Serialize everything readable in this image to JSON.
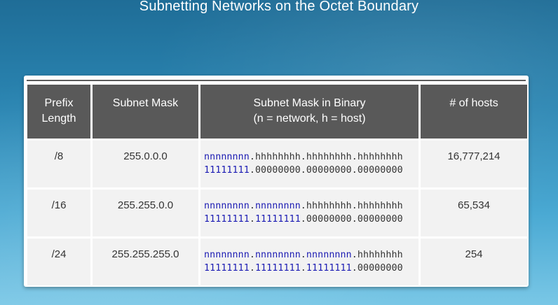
{
  "page": {
    "title": "Subnetting Networks on the Octet Boundary"
  },
  "table": {
    "headers": {
      "prefix_line1": "Prefix",
      "prefix_line2": "Length",
      "mask": "Subnet Mask",
      "binary_line1": "Subnet Mask in Binary",
      "binary_line2": "(n = network, h = host)",
      "hosts": "# of hosts"
    },
    "rows": [
      {
        "prefix": "/8",
        "mask": "255.0.0.0",
        "pattern": [
          "nnnnnnnn",
          "hhhhhhhh",
          "hhhhhhhh",
          "hhhhhhhh"
        ],
        "bits": [
          "11111111",
          "00000000",
          "00000000",
          "00000000"
        ],
        "hosts": "16,777,214"
      },
      {
        "prefix": "/16",
        "mask": "255.255.0.0",
        "pattern": [
          "nnnnnnnn",
          "nnnnnnnn",
          "hhhhhhhh",
          "hhhhhhhh"
        ],
        "bits": [
          "11111111",
          "11111111",
          "00000000",
          "00000000"
        ],
        "hosts": "65,534"
      },
      {
        "prefix": "/24",
        "mask": "255.255.255.0",
        "pattern": [
          "nnnnnnnn",
          "nnnnnnnn",
          "nnnnnnnn",
          "hhhhhhhh"
        ],
        "bits": [
          "11111111",
          "11111111",
          "11111111",
          "00000000"
        ],
        "hosts": "254"
      }
    ]
  },
  "colors": {
    "network_bits": "#1b1bb3",
    "host_bits": "#333333",
    "header_bg": "#595959",
    "cell_bg": "#f2f2f2"
  }
}
